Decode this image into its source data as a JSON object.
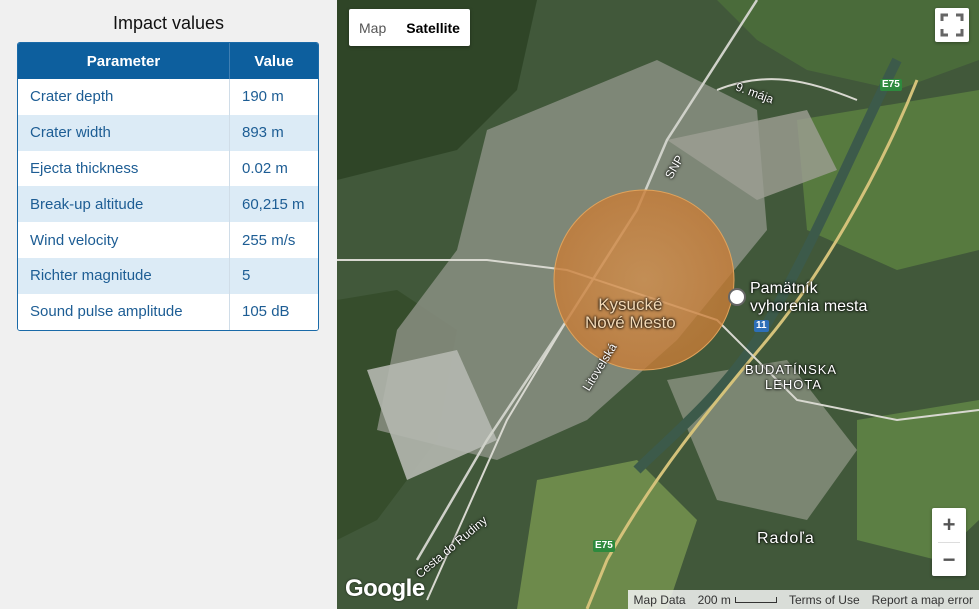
{
  "panel": {
    "title": "Impact values",
    "headers": {
      "param": "Parameter",
      "value": "Value"
    },
    "rows": [
      {
        "param": "Crater depth",
        "value": "190 m"
      },
      {
        "param": "Crater width",
        "value": "893 m"
      },
      {
        "param": "Ejecta thickness",
        "value": "0.02 m"
      },
      {
        "param": "Break-up altitude",
        "value": "60,215 m"
      },
      {
        "param": "Wind velocity",
        "value": "255 m/s"
      },
      {
        "param": "Richter magnitude",
        "value": "5"
      },
      {
        "param": "Sound pulse amplitude",
        "value": "105 dB"
      }
    ]
  },
  "map": {
    "type_control": {
      "map": "Map",
      "satellite": "Satellite",
      "active": "Satellite"
    },
    "labels": {
      "town": "Kysucké\nNové Mesto",
      "monument_line1": "Pamätník",
      "monument_line2": "vyhorenia mesta",
      "budatin_line1": "BUDATÍNSKA",
      "budatin_line2": "LEHOTA",
      "radola": "Radoľa",
      "street_snp": "SNP",
      "street_9maja": "9. mája",
      "street_litovelska": "Litovelská",
      "street_cesta": "Cesta do Rudiny"
    },
    "shields": {
      "e75_top": "E75",
      "e75_bottom": "E75",
      "route11": "11"
    },
    "logo": "Google",
    "attribution": {
      "map_data": "Map Data",
      "scale": "200 m",
      "terms": "Terms of Use",
      "report": "Report a map error"
    },
    "zoom": {
      "in": "+",
      "out": "−"
    },
    "colors": {
      "crater": "#d9904a",
      "header": "#0d5f9e",
      "road": "#d4c27a"
    }
  }
}
